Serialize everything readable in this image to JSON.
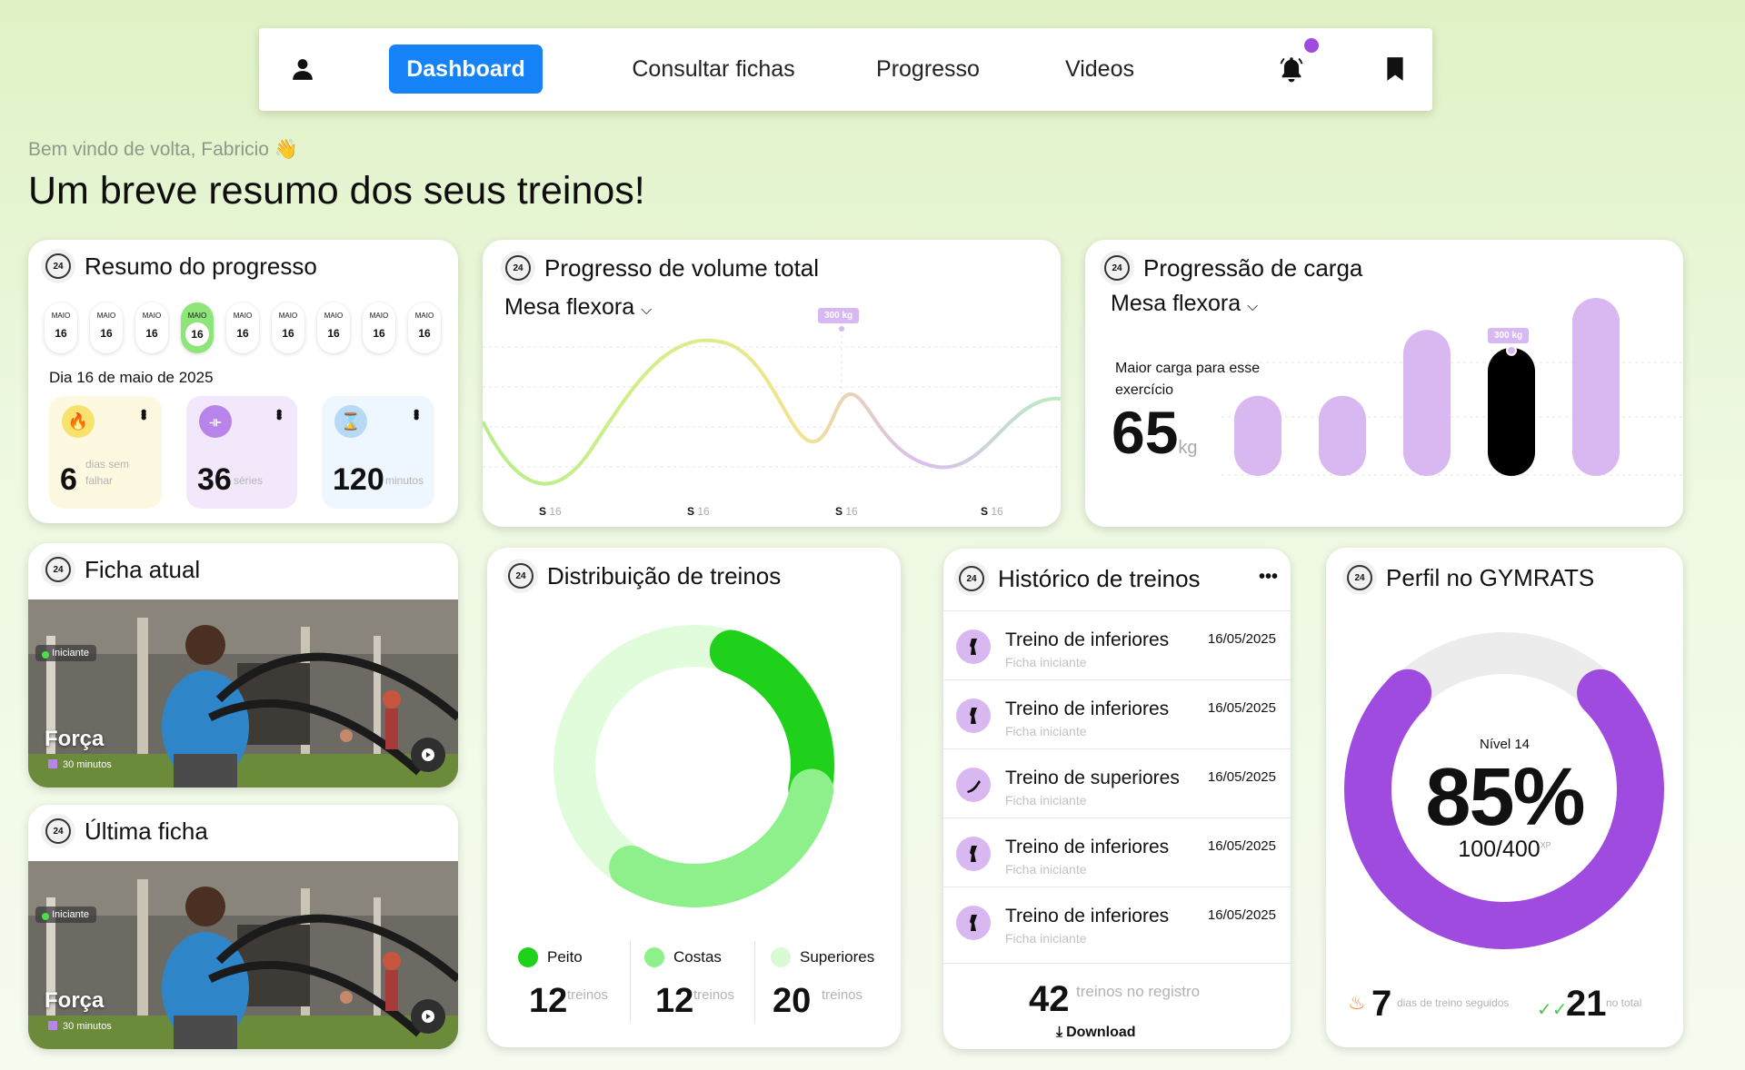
{
  "nav": {
    "dashboard": "Dashboard",
    "consultar": "Consultar fichas",
    "progresso": "Progresso",
    "videos": "Videos",
    "accent": "#1582f7"
  },
  "header": {
    "greeting": "Bem vindo de volta, Fabricio 👋",
    "headline": "Um breve resumo dos seus treinos!"
  },
  "resumo": {
    "title": "Resumo do progresso",
    "days": [
      {
        "m": "MAIO",
        "d": "16"
      },
      {
        "m": "MAIO",
        "d": "16"
      },
      {
        "m": "MAIO",
        "d": "16"
      },
      {
        "m": "MAIO",
        "d": "16"
      },
      {
        "m": "MAIO",
        "d": "16"
      },
      {
        "m": "MAIO",
        "d": "16"
      },
      {
        "m": "MAIO",
        "d": "16"
      },
      {
        "m": "MAIO",
        "d": "16"
      },
      {
        "m": "MAIO",
        "d": "16"
      }
    ],
    "selected_index": 3,
    "date_label": "Dia 16 de maio de 2025",
    "stats": [
      {
        "value": "6",
        "label": "dias sem falhar"
      },
      {
        "value": "36",
        "label": "séries"
      },
      {
        "value": "120",
        "label": "minutos"
      }
    ]
  },
  "volume": {
    "title": "Progresso de volume total",
    "exercise": "Mesa flexora",
    "tooltip": "300 kg",
    "x_labels": [
      "S",
      "S",
      "S",
      "S"
    ],
    "x_sub": "16"
  },
  "carga": {
    "title": "Progressão de carga",
    "exercise": "Mesa flexora",
    "max_label": "Maior carga para esse exercício",
    "max_value": "65",
    "max_unit": "kg",
    "tooltip": "300 kg",
    "bars": [
      0.45,
      0.45,
      0.82,
      0.72,
      1.0
    ],
    "highlight": 3
  },
  "ficha_atual": {
    "title": "Ficha atual",
    "tag": "Iniciante",
    "name": "Força",
    "duration": "30 minutos"
  },
  "ultima_ficha": {
    "title": "Última ficha",
    "tag": "Iniciante",
    "name": "Força",
    "duration": "30 minutos"
  },
  "distribuicao": {
    "title": "Distribuição de treinos",
    "items": [
      {
        "name": "Peito",
        "value": "12",
        "unit": "treinos",
        "color": "#1fd11a"
      },
      {
        "name": "Costas",
        "value": "12",
        "unit": "treinos",
        "color": "#8ef08a"
      },
      {
        "name": "Superiores",
        "value": "20",
        "unit": "treinos",
        "color": "#d9fbd4"
      }
    ]
  },
  "historico": {
    "title": "Histórico de treinos",
    "rows": [
      {
        "name": "Treino de inferiores",
        "sub": "Ficha iniciante",
        "date": "16/05/2025"
      },
      {
        "name": "Treino de inferiores",
        "sub": "Ficha iniciante",
        "date": "16/05/2025"
      },
      {
        "name": "Treino de superiores",
        "sub": "Ficha iniciante",
        "date": "16/05/2025"
      },
      {
        "name": "Treino de inferiores",
        "sub": "Ficha iniciante",
        "date": "16/05/2025"
      },
      {
        "name": "Treino de inferiores",
        "sub": "Ficha iniciante",
        "date": "16/05/2025"
      }
    ],
    "total": "42",
    "total_label": "treinos no registro",
    "download": "Download"
  },
  "perfil": {
    "title": "Perfil no GYMRATS",
    "level": "Nível 14",
    "percent": "85%",
    "progress": 0.85,
    "xp": "100/400",
    "xp_unit": "XP",
    "streak": "7",
    "streak_label": "dias de treino seguidos",
    "total": "21",
    "total_label": "no total",
    "accent": "#a04be0"
  }
}
